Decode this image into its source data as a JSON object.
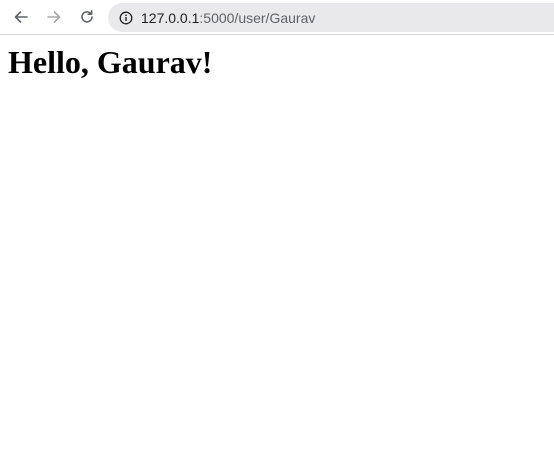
{
  "browser": {
    "url_host": "127.0.0.1",
    "url_path": ":5000/user/Gaurav",
    "icons": {
      "back": "arrow-left-icon",
      "forward": "arrow-right-icon",
      "reload": "reload-icon",
      "site_info": "info-icon"
    },
    "colors": {
      "omnibox_bg": "#e9e9eb",
      "icon": "#5f6368",
      "icon_disabled": "#a8a8a8"
    }
  },
  "page": {
    "heading": "Hello, Gaurav!"
  }
}
